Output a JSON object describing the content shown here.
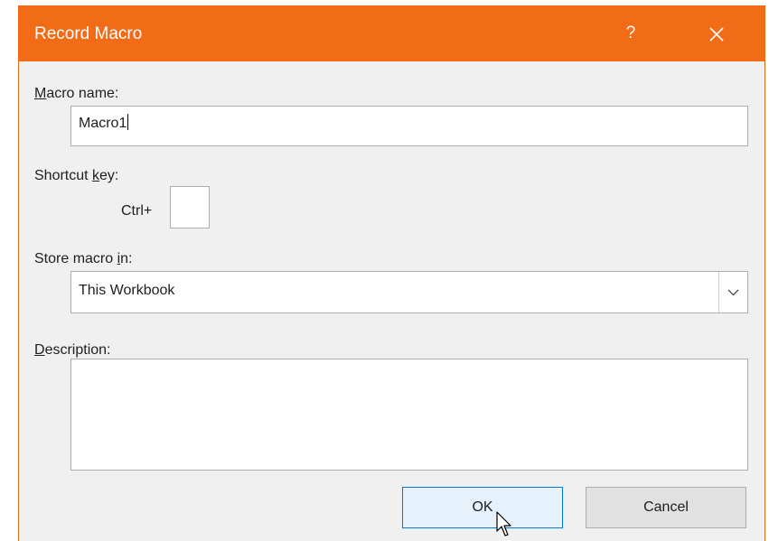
{
  "window": {
    "title": "Record Macro",
    "help_glyph": "?",
    "accent_color": "#f26b16"
  },
  "macro_name": {
    "label_mnemonic": "M",
    "label_rest": "acro name:",
    "value": "Macro1"
  },
  "shortcut": {
    "label_before": "Shortcut ",
    "label_mnemonic": "k",
    "label_after": "ey:",
    "prefix": "Ctrl+",
    "value": ""
  },
  "store": {
    "label_before": "Store macro ",
    "label_mnemonic": "i",
    "label_after": "n:",
    "selected": "This Workbook"
  },
  "description": {
    "label_mnemonic": "D",
    "label_rest": "escription:",
    "value": ""
  },
  "buttons": {
    "ok": "OK",
    "cancel": "Cancel"
  }
}
